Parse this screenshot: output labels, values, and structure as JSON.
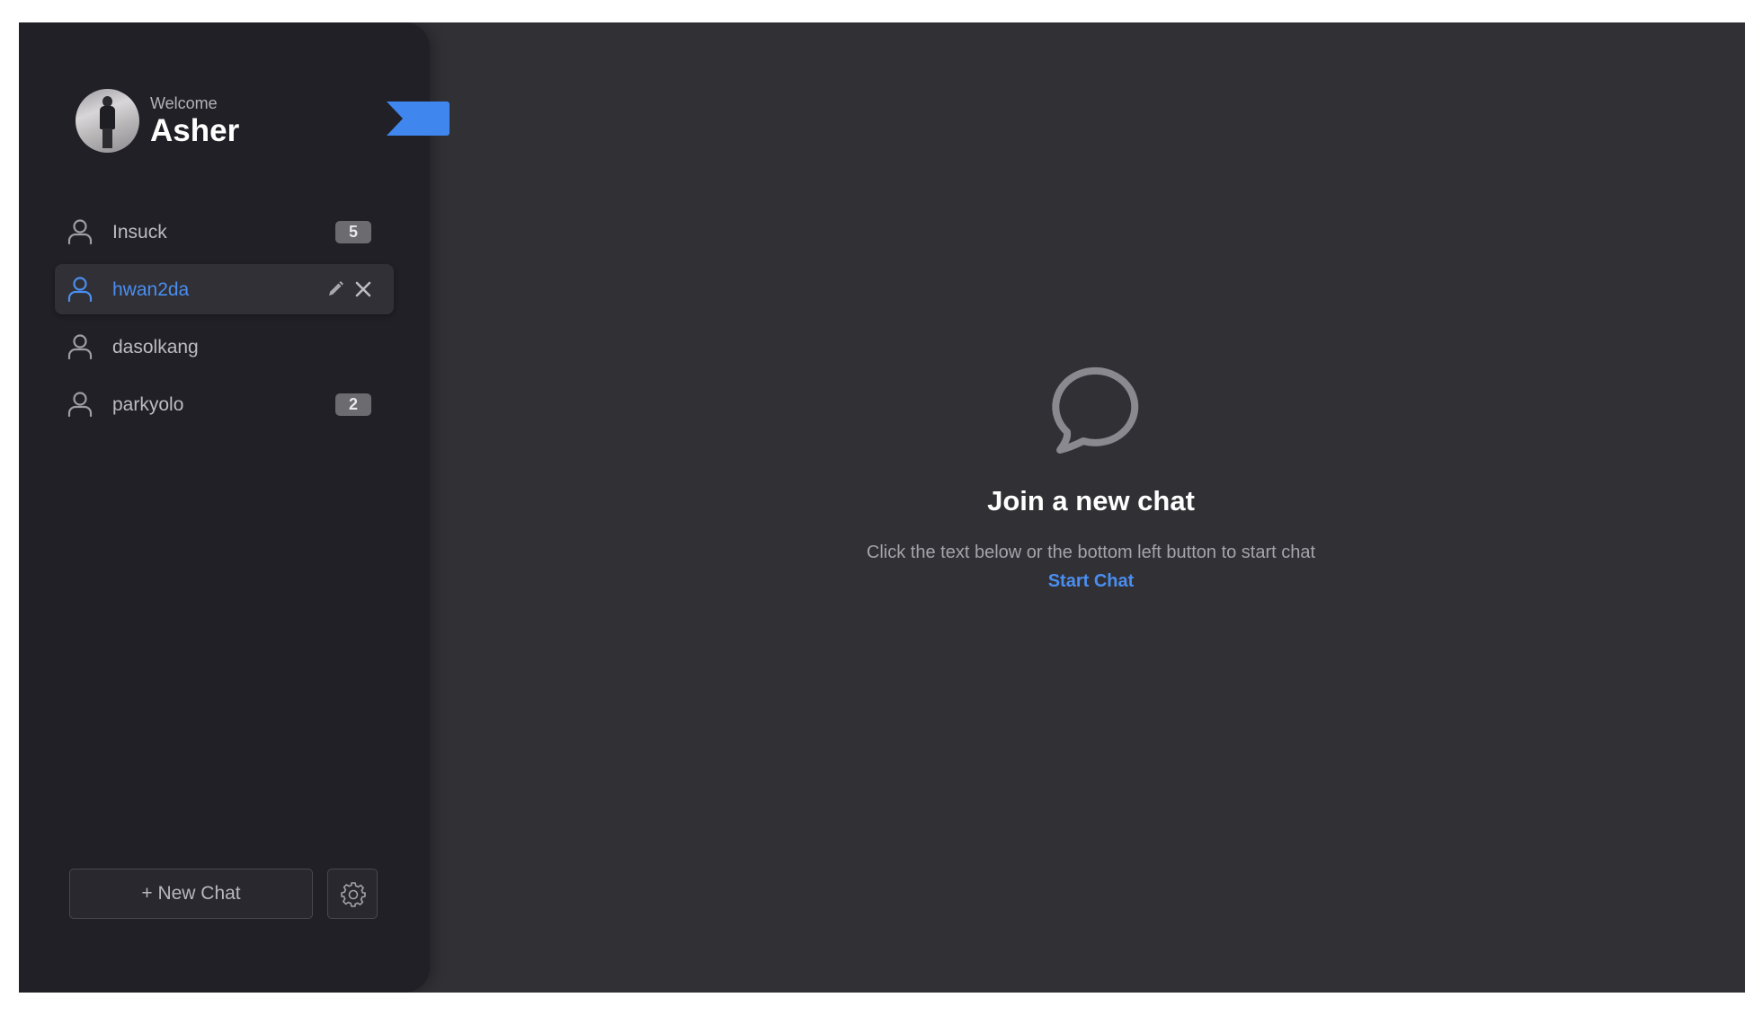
{
  "profile": {
    "welcome_label": "Welcome",
    "user_name": "Asher"
  },
  "chats": [
    {
      "name": "Insuck",
      "unread": "5",
      "active": false
    },
    {
      "name": "hwan2da",
      "unread": "",
      "active": true
    },
    {
      "name": "dasolkang",
      "unread": "",
      "active": false
    },
    {
      "name": "parkyolo",
      "unread": "2",
      "active": false
    }
  ],
  "sidebar_footer": {
    "new_chat_label": "+ New Chat",
    "settings_icon": "gear-icon"
  },
  "empty_state": {
    "icon": "chat-bubble-icon",
    "title": "Join a new chat",
    "subtitle": "Click the text below or the bottom left button to start chat",
    "link_label": "Start Chat"
  },
  "colors": {
    "accent": "#4a8ef0",
    "sidebar_bg": "#212026",
    "main_bg": "#313035",
    "badge_bg": "#6c6b70"
  }
}
